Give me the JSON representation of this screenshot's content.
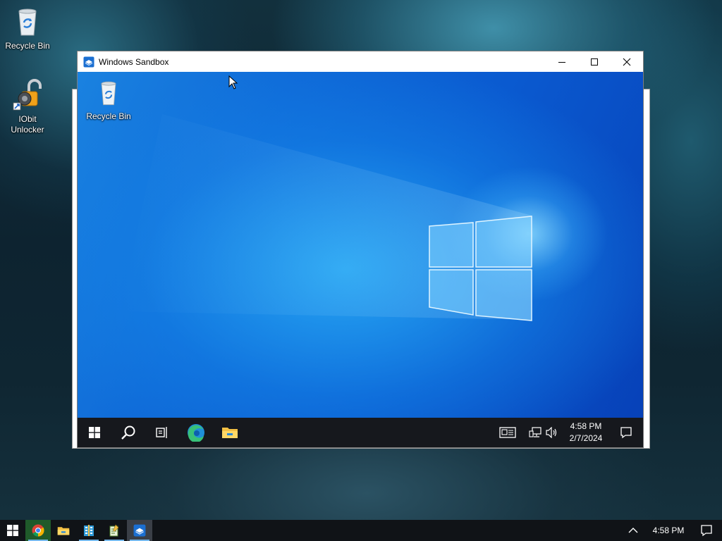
{
  "host_desktop": {
    "icons": [
      {
        "label": "Recycle Bin",
        "icon": "recycle-bin-icon"
      },
      {
        "label": "IObit Unlocker",
        "icon": "iobit-unlocker-icon"
      }
    ]
  },
  "sandbox_window": {
    "title": "Windows Sandbox",
    "app_icon": "windows-sandbox-icon",
    "controls": {
      "minimize": "minimize-icon",
      "maximize": "maximize-icon",
      "close": "close-icon"
    },
    "guest": {
      "desktop_icons": [
        {
          "label": "Recycle Bin",
          "icon": "recycle-bin-icon"
        }
      ],
      "taskbar": {
        "pinned": [
          "start-icon",
          "search-icon",
          "task-view-icon",
          "edge-icon",
          "file-explorer-icon"
        ],
        "tray": [
          "news-widget-icon",
          "network-icon",
          "volume-icon"
        ],
        "time": "4:58 PM",
        "date": "2/7/2024",
        "notification_icon": "action-center-icon"
      }
    }
  },
  "host_taskbar": {
    "apps": [
      {
        "icon": "start-icon",
        "state": "normal"
      },
      {
        "icon": "chrome-icon",
        "state": "running"
      },
      {
        "icon": "file-explorer-icon",
        "state": "normal"
      },
      {
        "icon": "building-app-icon",
        "state": "running"
      },
      {
        "icon": "notepad-app-icon",
        "state": "running"
      },
      {
        "icon": "windows-sandbox-icon",
        "state": "active"
      }
    ],
    "tray": {
      "chevron": "show-hidden-icons-chevron-icon",
      "time": "4:58 PM",
      "notification_icon": "action-center-icon"
    }
  },
  "colors": {
    "guest_wallpaper": "#0a5ad0",
    "taskbar": "#101317",
    "running_indicator": "#76b9ed"
  }
}
